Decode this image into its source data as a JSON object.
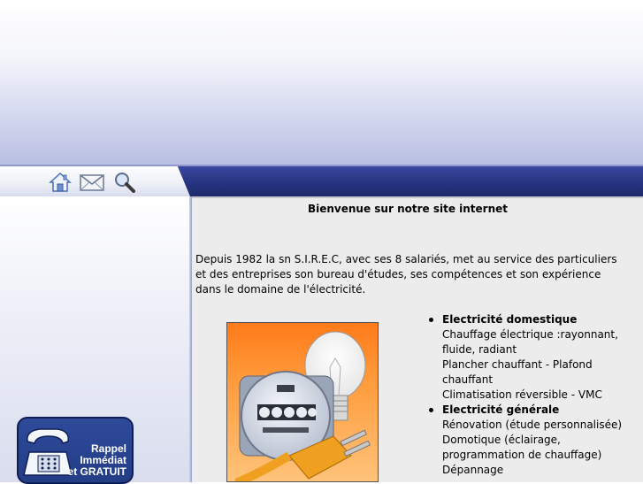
{
  "nav": {
    "icons": [
      "home-icon",
      "mail-icon",
      "search-icon"
    ]
  },
  "main": {
    "welcome": "Bienvenue sur notre site internet",
    "intro": "Depuis 1982 la sn S.I.R.E.C, avec ses 8 salariés, met au service des particuliers et des entreprises son bureau d'études, ses compétences et son expérience dans le domaine de l'électricité.",
    "services": [
      {
        "title": "Electricité domestique",
        "items": [
          "Chauffage électrique :rayonnant, fluide, radiant",
          "Plancher chauffant - Plafond chauffant",
          "Climatisation réversible - VMC"
        ]
      },
      {
        "title": "Electricité générale",
        "items": [
          "Rénovation (étude personnalisée)",
          "Domotique (éclairage, programmation de chauffage)",
          "Dépannage"
        ]
      }
    ]
  },
  "callback": {
    "line1": "Rappel",
    "line2": "Immédiat",
    "line3": "et GRATUIT"
  },
  "colors": {
    "navbar": "#26337e",
    "content_bg": "#ececec",
    "illustration_orange": "#ff8a2a",
    "callback_blue": "#2e4a9a"
  }
}
